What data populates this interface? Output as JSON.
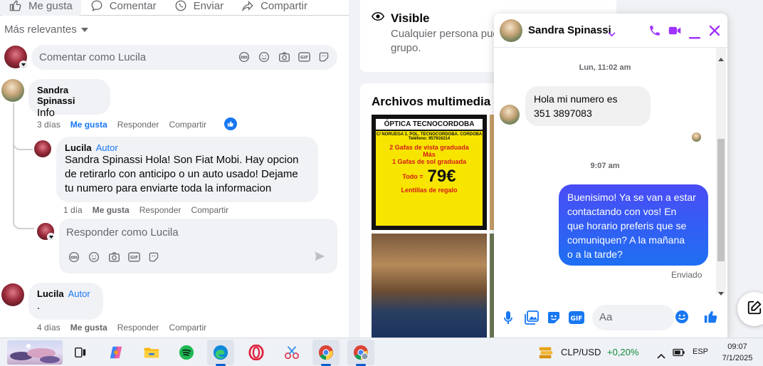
{
  "post_actions": {
    "like": "Me gusta",
    "comment": "Comentar",
    "send": "Enviar",
    "share": "Compartir"
  },
  "sort": {
    "label": "Más relevantes"
  },
  "comment_box": {
    "placeholder": "Comentar como Lucila"
  },
  "comments": [
    {
      "author": "Sandra Spinassi",
      "text": "Info",
      "time": "3 días",
      "like": "Me gusta",
      "reply": "Responder",
      "share": "Compartir"
    },
    {
      "author": "Lucila",
      "role": "Autor",
      "text": "Sandra Spinassi Hola! Son Fiat Mobi. Hay opcion de retirarlo con anticipo o un auto usado! Dejame tu numero para enviarte toda la informacion",
      "time": "1 día",
      "like": "Me gusta",
      "reply": "Responder",
      "share": "Compartir"
    },
    {
      "author": "Lucila",
      "role": "Autor",
      "text": ".",
      "time": "4 días",
      "like": "Me gusta",
      "reply": "Responder",
      "share": "Compartir"
    }
  ],
  "reply_box": {
    "placeholder": "Responder como Lucila"
  },
  "group_info": {
    "title": "Visible",
    "description": "Cualquier persona pue",
    "description2": "grupo."
  },
  "media": {
    "title": "Archivos multimedia re",
    "optica": {
      "heading": "ÓPTICA TECNOCORDOBA",
      "address": "C/ NORUEGA 1. POL. TECNOCORDOBA. CORDOBA",
      "phone": "Teléfono: 957916214",
      "line1": "2 Gafas de vista graduada",
      "line2": "Más",
      "line3": "1 Gafas de sol graduada",
      "todo": "Todo =",
      "price": "79€",
      "footer": "Lentillas de regalo"
    }
  },
  "chat": {
    "contact": "Sandra Spinassi",
    "timestamp1": "Lun, 11:02 am",
    "incoming": [
      "Hola mi numero es",
      "351 3897083"
    ],
    "timestamp2": "9:07 am",
    "outgoing": [
      "Buenisimo! Ya se van a estar",
      "contactando con vos! En",
      "que horario preferis que se",
      "comuniquen? A la mañana",
      "o a la tarde?"
    ],
    "status": "Enviado",
    "input_placeholder": "Aa"
  },
  "taskbar": {
    "currency": "CLP/USD",
    "change": "+0,20%",
    "lang": "ESP",
    "time": "09:07",
    "date": "7/1/2025",
    "apps": [
      "task-view",
      "copilot",
      "file-explorer",
      "spotify",
      "edge",
      "opera",
      "snipping-tool",
      "chrome",
      "chrome-profile"
    ]
  },
  "colors": {
    "accent": "#1877f2",
    "messenger_purple": "#a033ff",
    "outgoing_bubble": "#2f6cf5",
    "positive": "#0f8a3a"
  }
}
